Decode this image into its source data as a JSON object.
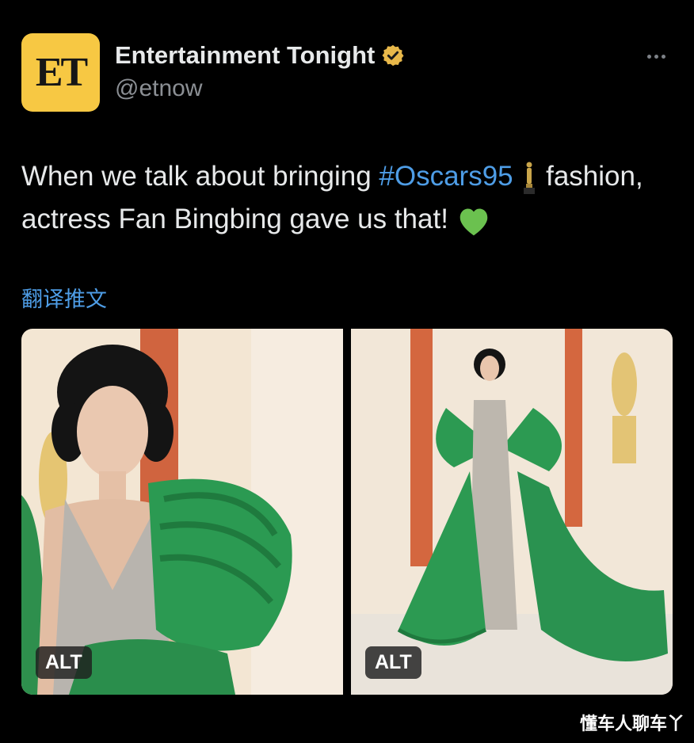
{
  "account": {
    "avatar_text": "ET",
    "display_name": "Entertainment Tonight",
    "handle": "@etnow",
    "verified_icon": "verified-badge-icon",
    "brand_color": "#f7c843",
    "verified_color": "#e8b84a"
  },
  "tweet": {
    "text_part1": "When we talk about bringing ",
    "hashtag": "#Oscars95",
    "text_part2": " fashion, actress Fan Bingbing gave us that! ",
    "emoji_1": "oscar-statuette-icon",
    "emoji_2": "green-heart-icon",
    "translate_label": "翻译推文",
    "link_color": "#4e9de6"
  },
  "media": {
    "photos": [
      {
        "alt_label": "ALT",
        "subject": "photo-closeup"
      },
      {
        "alt_label": "ALT",
        "subject": "photo-full-length"
      }
    ]
  },
  "watermark": "懂车人聊车丫",
  "more_icon": "more-options-icon"
}
